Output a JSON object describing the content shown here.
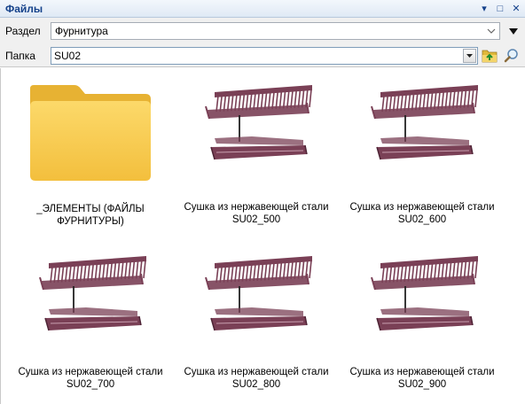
{
  "window": {
    "title": "Файлы",
    "buttons": {
      "pin": "▾",
      "restore": "□",
      "close": "✕"
    }
  },
  "toolbar": {
    "section": {
      "label": "Раздел",
      "value": "Фурнитура"
    },
    "folder": {
      "label": "Папка",
      "value": "SU02"
    },
    "icons": {
      "up": "folder-up-icon",
      "search": "search-icon",
      "menu": "menu-arrow-icon"
    }
  },
  "items": [
    {
      "type": "folder",
      "line1": "_ЭЛЕМЕНТЫ (ФАЙЛЫ ФУРНИТУРЫ)",
      "line2": ""
    },
    {
      "type": "dryer",
      "line1": "Сушка из нержавеющей стали",
      "line2": "SU02_500"
    },
    {
      "type": "dryer",
      "line1": "Сушка из нержавеющей стали",
      "line2": "SU02_600"
    },
    {
      "type": "dryer",
      "line1": "Сушка из нержавеющей стали",
      "line2": "SU02_700"
    },
    {
      "type": "dryer",
      "line1": "Сушка из нержавеющей стали",
      "line2": "SU02_800"
    },
    {
      "type": "dryer",
      "line1": "Сушка из нержавеющей стали",
      "line2": "SU02_900"
    }
  ],
  "colors": {
    "accent": "#15428b",
    "dryer": "#7a4056",
    "folder": "#f6c84c"
  }
}
